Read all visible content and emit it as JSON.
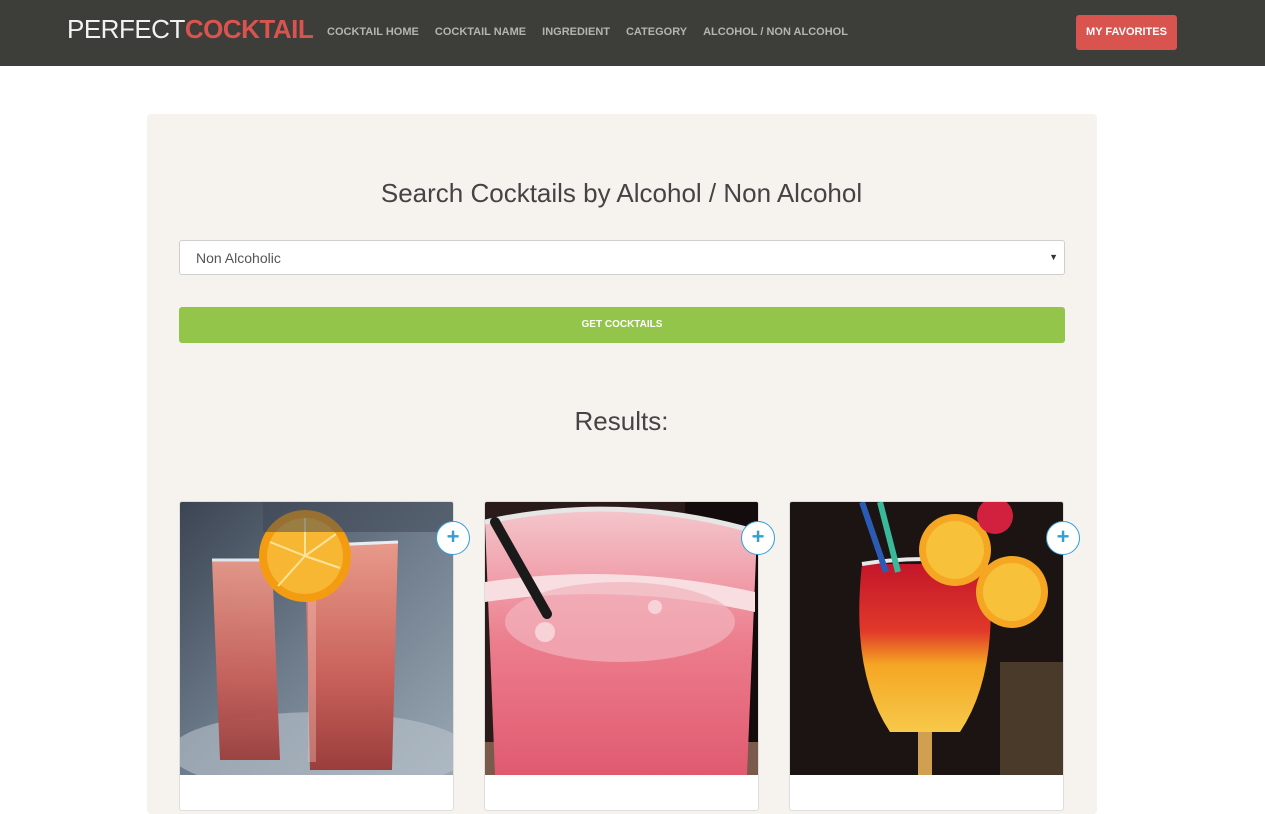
{
  "brand": {
    "light": "PERFECT",
    "bold": "COCKTAIL"
  },
  "nav": {
    "items": [
      {
        "label": "COCKTAIL HOME"
      },
      {
        "label": "COCKTAIL NAME"
      },
      {
        "label": "INGREDIENT"
      },
      {
        "label": "CATEGORY"
      },
      {
        "label": "ALCOHOL / NON ALCOHOL"
      }
    ],
    "favorites_label": "MY FAVORITES"
  },
  "search": {
    "title": "Search Cocktails by Alcohol / Non Alcohol",
    "selected_option": "Non Alcoholic",
    "submit_label": "GET COCKTAILS"
  },
  "results": {
    "title": "Results:",
    "cards": [
      {
        "image": "pink-drinks-with-orange-slice-photo",
        "add_label": "+"
      },
      {
        "image": "pink-frothy-drink-photo",
        "add_label": "+"
      },
      {
        "image": "sunset-gradient-drink-with-orange-photo",
        "add_label": "+"
      }
    ]
  },
  "colors": {
    "navbar": "#3d3d3a",
    "brand_accent": "#d9534f",
    "panel": "#f6f3ef",
    "button_green": "#93c54b",
    "add_icon_blue": "#2f9fd6"
  }
}
